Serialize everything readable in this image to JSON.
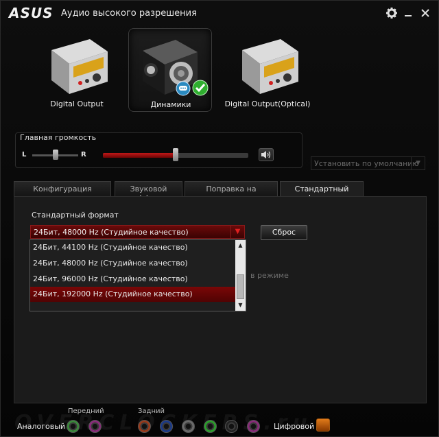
{
  "app": {
    "logo": "ASUS",
    "title": "Аудио высокого разрешения",
    "settings_icon": "gear-icon",
    "close_icon": "close-icon"
  },
  "devices": [
    {
      "label": "Digital Output",
      "icon": "digital-output-device-icon"
    },
    {
      "label": "Динамики",
      "icon": "speaker-device-icon",
      "selected": true
    },
    {
      "label": "Digital Output(Optical)",
      "icon": "optical-output-device-icon"
    }
  ],
  "volume": {
    "title": "Главная громкость",
    "left_label": "L",
    "right_label": "R",
    "balance_level": 0.5,
    "master_level": 0.5,
    "mute_icon": "speaker-volume-icon"
  },
  "default_button": "Установить по умолчанию",
  "tabs": [
    {
      "label": "Конфигурация динамиков"
    },
    {
      "label": "Звуковой эффект"
    },
    {
      "label": "Поправка на помещение"
    },
    {
      "label": "Стандартный формат",
      "active": true
    }
  ],
  "format": {
    "section_label": "Стандартный формат",
    "selected_value": "24Бит, 48000 Hz (Студийное качество)",
    "reset_label": "Сброс",
    "background_text": "в режиме",
    "options": [
      "24Бит, 44100 Hz (Студийное качество)",
      "24Бит, 48000 Hz (Студийное качество)",
      "24Бит, 96000 Hz (Студийное качество)",
      "24Бит, 192000 Hz (Студийное качество)"
    ],
    "highlighted_option_index": 3
  },
  "jacks": {
    "analog_label": "Аналоговый",
    "front_label": "Передний",
    "rear_label": "Задний",
    "digital_label": "Цифровой",
    "front_colors": [
      "#3a8a3a",
      "#8a2a7a"
    ],
    "rear_colors": [
      "#9a3a1a",
      "#1a3a8a",
      "#6a6a6a",
      "#2aa02a",
      "#333333",
      "#8a2a7a"
    ]
  },
  "watermark": "OVERCLOCKERS.ru"
}
